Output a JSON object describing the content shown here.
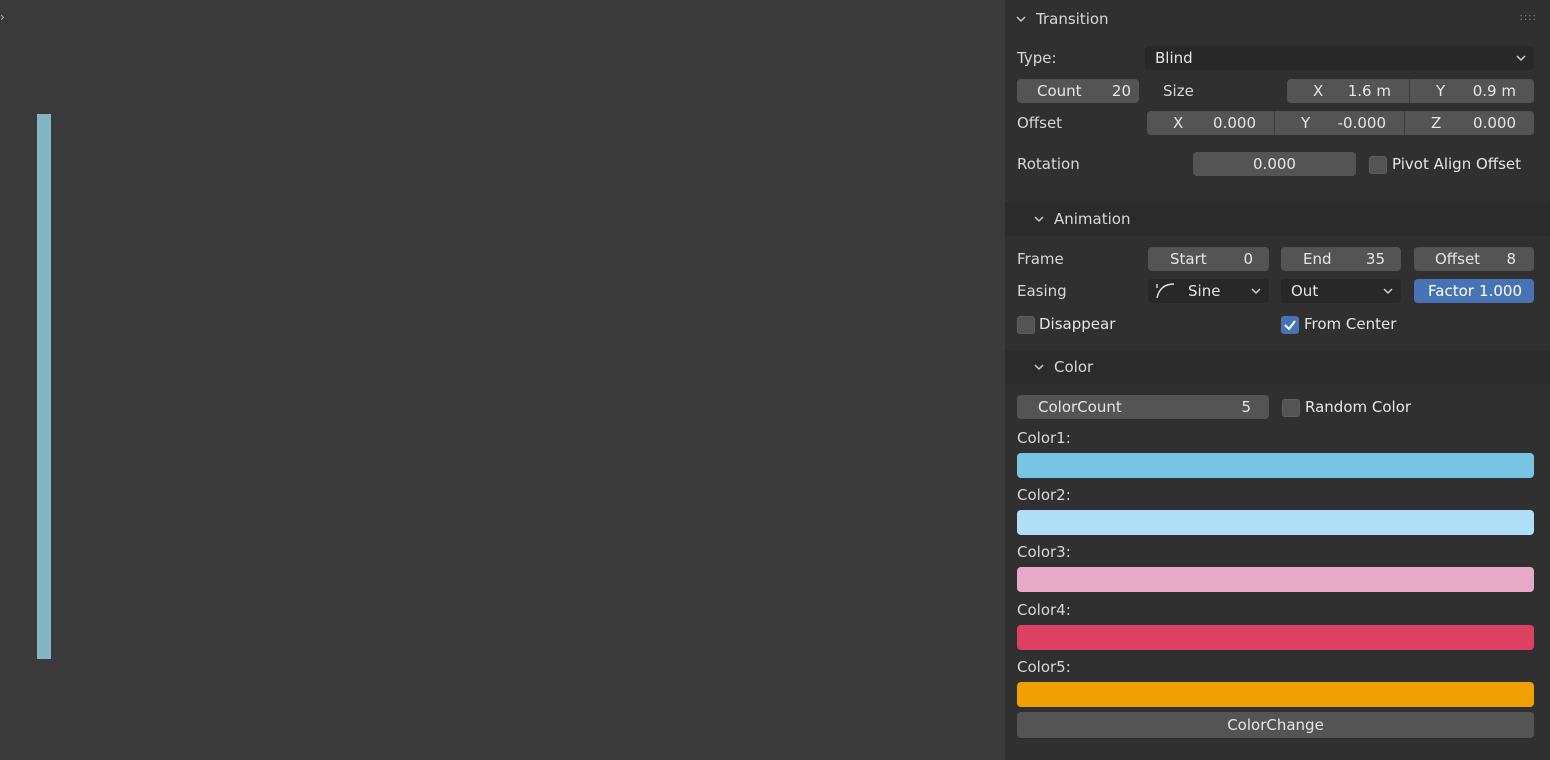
{
  "panel": {
    "title": "Transition",
    "type_label": "Type:",
    "type_value": "Blind",
    "count_label": "Count",
    "count_value": "20",
    "size_label": "Size",
    "size_x_label": "X",
    "size_x_value": "1.6 m",
    "size_y_label": "Y",
    "size_y_value": "0.9 m",
    "offset_label": "Offset",
    "offset_x_label": "X",
    "offset_x_value": "0.000",
    "offset_y_label": "Y",
    "offset_y_value": "-0.000",
    "offset_z_label": "Z",
    "offset_z_value": "0.000",
    "rotation_label": "Rotation",
    "rotation_value": "0.000",
    "pivot_align_label": "Pivot Align Offset",
    "pivot_align_checked": false
  },
  "animation": {
    "title": "Animation",
    "frame_label": "Frame",
    "start_label": "Start",
    "start_value": "0",
    "end_label": "End",
    "end_value": "35",
    "offset_label": "Offset",
    "offset_value": "8",
    "easing_label": "Easing",
    "easing_value": "Sine",
    "easing_mode": "Out",
    "factor_label": "Factor",
    "factor_value": "1.000",
    "disappear_label": "Disappear",
    "disappear_checked": false,
    "from_center_label": "From Center",
    "from_center_checked": true
  },
  "color": {
    "title": "Color",
    "colorcount_label": "ColorCount",
    "colorcount_value": "5",
    "random_color_label": "Random Color",
    "random_color_checked": false,
    "swatches": [
      {
        "label": "Color1:",
        "hex": "#77c4e3"
      },
      {
        "label": "Color2:",
        "hex": "#aedff7"
      },
      {
        "label": "Color3:",
        "hex": "#e8a8c8"
      },
      {
        "label": "Color4:",
        "hex": "#de4062"
      },
      {
        "label": "Color5:",
        "hex": "#f0a000"
      }
    ],
    "change_button": "ColorChange"
  },
  "viewport": {
    "strip_color": "#82b5c1",
    "toggle_icon": "chevron-right-icon"
  }
}
